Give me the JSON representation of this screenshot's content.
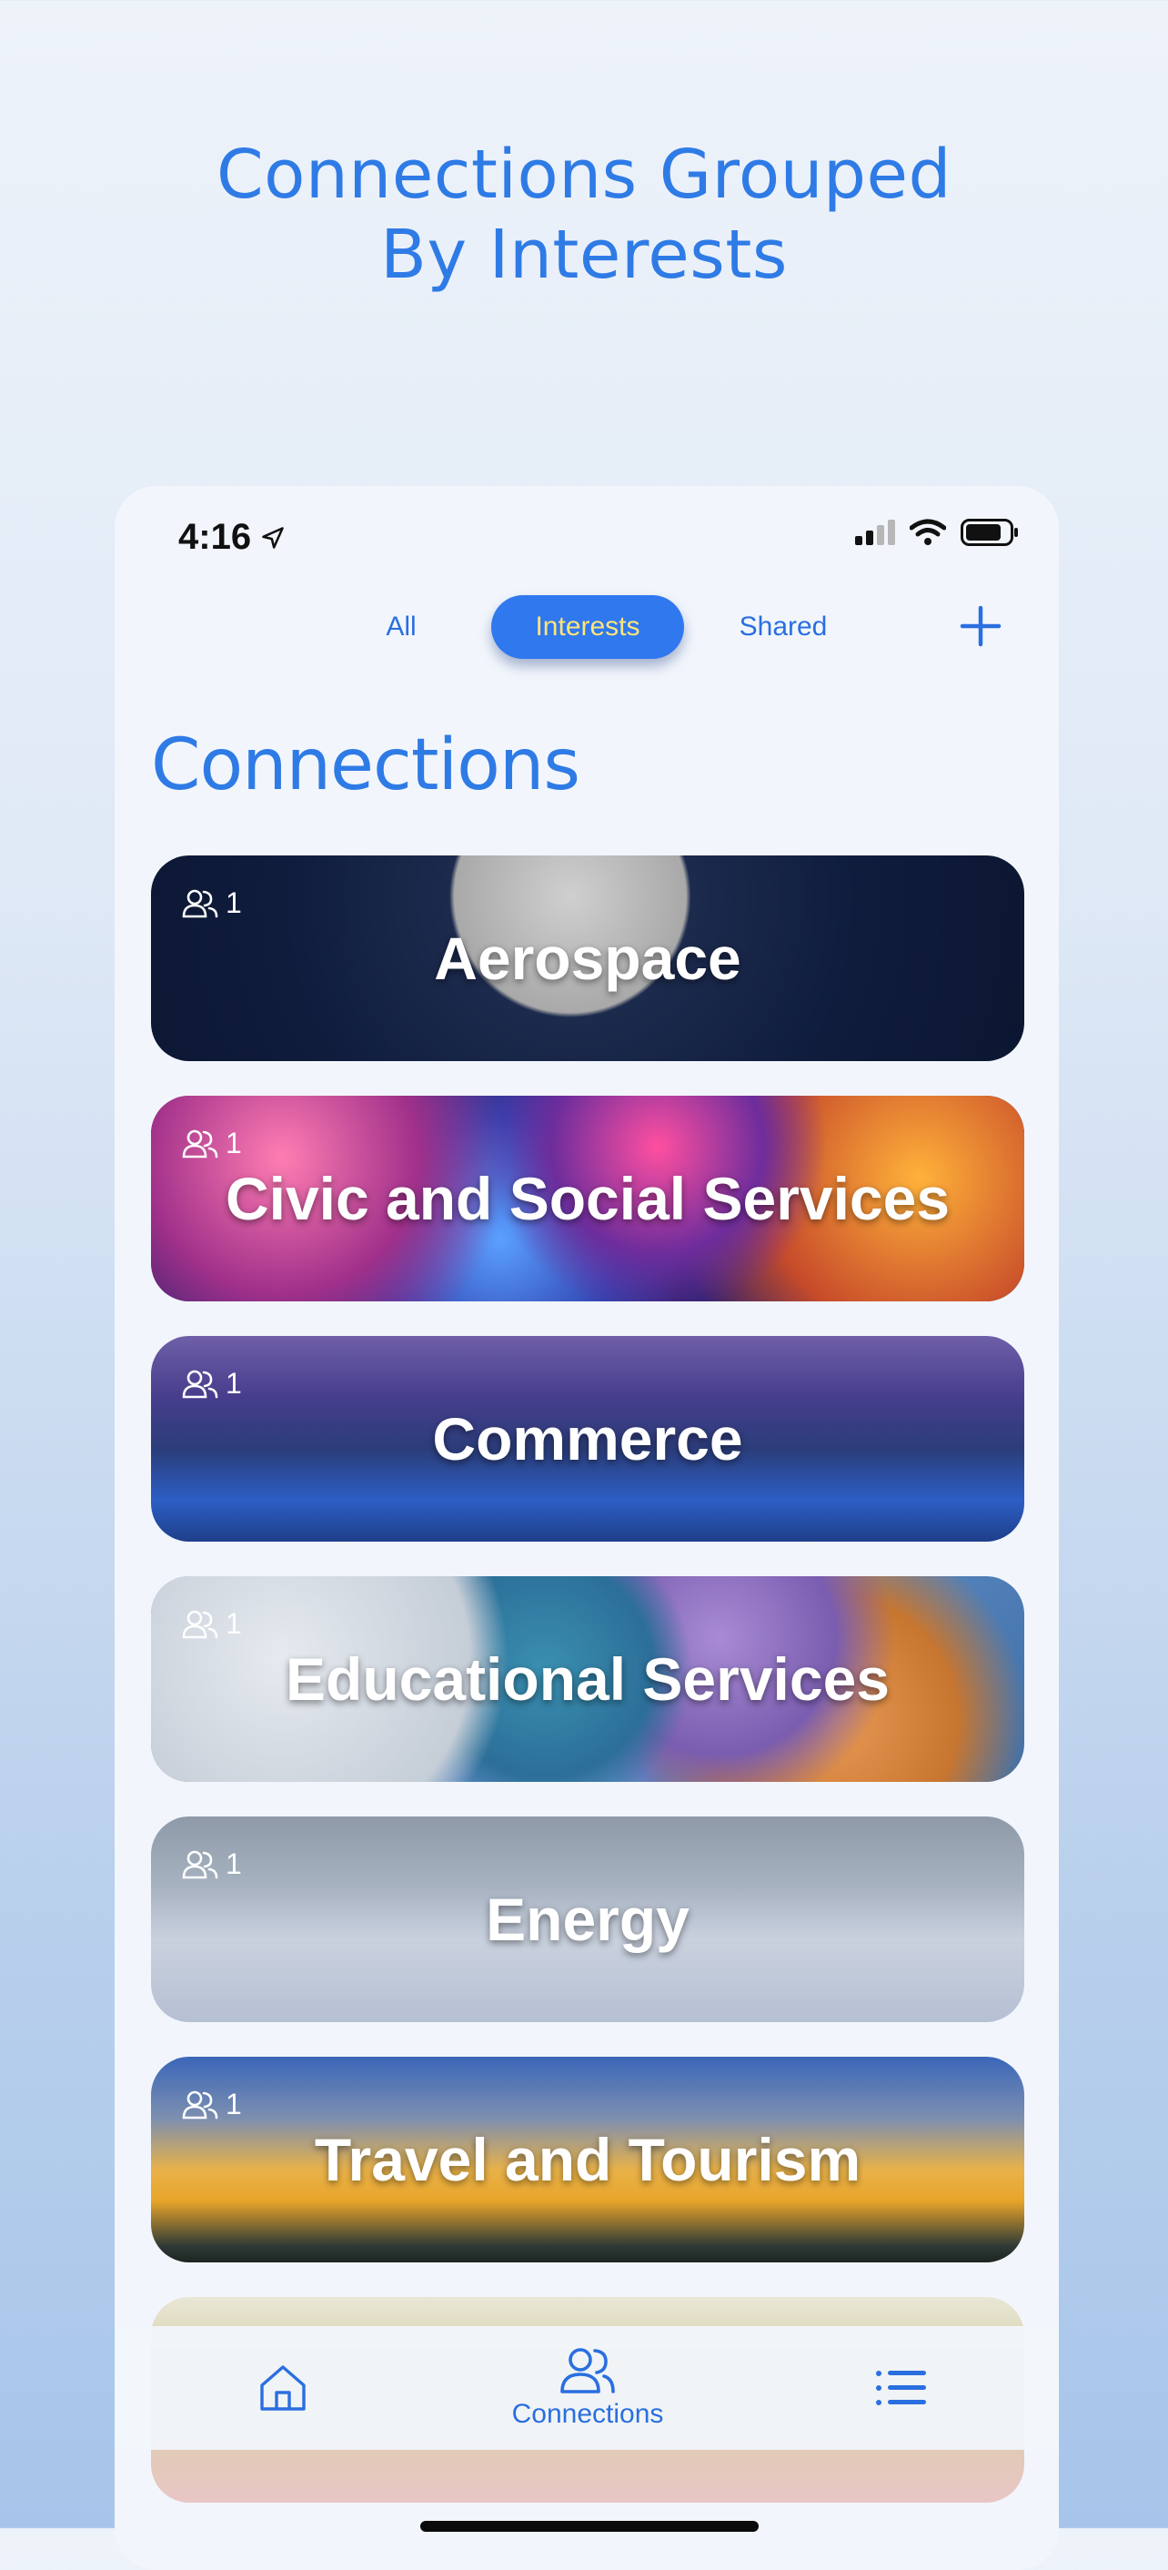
{
  "promo": {
    "title_line1": "Connections Grouped",
    "title_line2": "By Interests"
  },
  "status_bar": {
    "time": "4:16",
    "icons": [
      "location-arrow-icon",
      "signal-icon",
      "wifi-icon",
      "battery-icon"
    ]
  },
  "segment": {
    "items": [
      "All",
      "Interests",
      "Shared"
    ],
    "selected": "Interests"
  },
  "page": {
    "heading": "Connections"
  },
  "cards": [
    {
      "title": "Aerospace",
      "count": "1"
    },
    {
      "title": "Civic and Social Services",
      "count": "1"
    },
    {
      "title": "Commerce",
      "count": "1"
    },
    {
      "title": "Educational Services",
      "count": "1"
    },
    {
      "title": "Energy",
      "count": "1"
    },
    {
      "title": "Travel and Tourism",
      "count": "1"
    }
  ],
  "tab_bar": {
    "connections_label": "Connections",
    "active": "Connections"
  },
  "colors": {
    "accent": "#2f7be6",
    "segment_selected_bg": "#2f78ee",
    "segment_selected_text": "#ffe47a"
  }
}
